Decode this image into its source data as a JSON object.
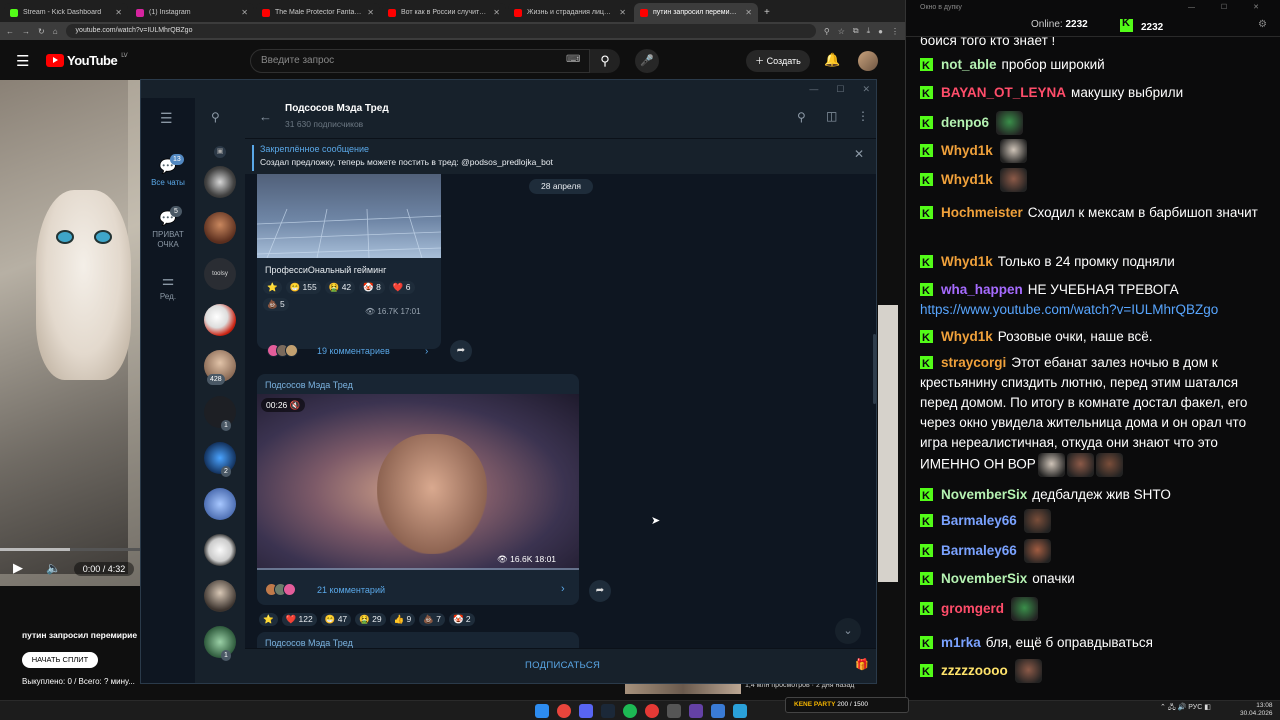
{
  "browser": {
    "tabs": [
      {
        "title": "Stream - Kick Dashboard",
        "color": "#53fc18"
      },
      {
        "title": "(1) Instagram",
        "color": "#d6249f"
      },
      {
        "title": "The Male Protector Fantasy | ",
        "color": "#ff0000"
      },
      {
        "title": "Вот как в России случится де",
        "color": "#ff0000"
      },
      {
        "title": "Жизнь и страдания лицемер",
        "color": "#ff0000"
      },
      {
        "title": "путин запросил перемирие",
        "color": "#ff0000"
      }
    ],
    "new_tab": "+",
    "url": "youtube.com/watch?v=IULMhrQBZgo"
  },
  "youtube": {
    "logo_text": "YouTube",
    "region": "LV",
    "search_placeholder": "Введите запрос",
    "create_label": "Создать",
    "timecode": "0:00 / 4:32",
    "progress": 0.0,
    "video_title": "путин запросил перемирие",
    "split_label": "НАЧАТЬ СПЛИТ",
    "bought": "Выкуплено: 0 / Всего: ? мину...",
    "views_strip": "1,4 млн просмотров · 2 дня назад"
  },
  "telegram": {
    "rail": {
      "all_chats": "Все чаты",
      "all_badge": "13",
      "private_label": "ПРИВАТ ОЧКА",
      "private_badge": "5",
      "edit_label": "Ред."
    },
    "chat_list_badges": [
      "428",
      "1",
      "2",
      "1"
    ],
    "list_label_toolsy": "toolsy",
    "channel_name": "Подсосов Мэда Тред",
    "subscribers": "31 630 подписчиков",
    "pinned_title": "Закреплённое сообщение",
    "pinned_text": "Создал предложку, теперь можете  постить в тред: @podsos_predlojka_bot",
    "date": "28 апреля",
    "post1": {
      "caption": "ПрофессиОнальный гейминг",
      "reactions": [
        {
          "emoji": "⭐",
          "count": ""
        },
        {
          "emoji": "😁",
          "count": "155"
        },
        {
          "emoji": "🤮",
          "count": "42"
        },
        {
          "emoji": "🤡",
          "count": "8"
        },
        {
          "emoji": "❤️",
          "count": "6"
        },
        {
          "emoji": "💩",
          "count": "5"
        }
      ],
      "views": "16.7K",
      "time": "17:01",
      "comments": "19 комментариев"
    },
    "post2": {
      "sender": "Подсосов Мэда Тред",
      "duration": "00:26",
      "views": "16.6K",
      "time": "18:01",
      "comments": "21 комментарий",
      "reactions": [
        {
          "emoji": "⭐",
          "count": ""
        },
        {
          "emoji": "❤️",
          "count": "122"
        },
        {
          "emoji": "😁",
          "count": "47"
        },
        {
          "emoji": "🤮",
          "count": "29"
        },
        {
          "emoji": "👍",
          "count": "9"
        },
        {
          "emoji": "💩",
          "count": "7"
        },
        {
          "emoji": "🤡",
          "count": "2"
        }
      ]
    },
    "post3_sender": "Подсосов Мэда Тред",
    "subscribe_label": "ПОДПИСАТЬСЯ"
  },
  "chat": {
    "window_title": "Окно в дупку",
    "online_label": "Online:",
    "online_count": "2232",
    "kick_count": "2232",
    "accent": "#53fc18",
    "messages": [
      {
        "user": "",
        "color": "#ffffff",
        "text": "боися того кто знает !",
        "emotes": 0
      },
      {
        "user": "not_able",
        "color": "#b5f2b2",
        "text": "пробор широкий",
        "emotes": 0
      },
      {
        "user": "BAYAN_OT_LEYNA",
        "color": "#ff4d6a",
        "text": "макушку выбрили",
        "emotes": 0
      },
      {
        "user": "denpo6",
        "color": "#b5f2b2",
        "text": "",
        "emotes": 1
      },
      {
        "user": "Whyd1k",
        "color": "#f0a13b",
        "text": "",
        "emotes": 1
      },
      {
        "user": "Whyd1k",
        "color": "#f0a13b",
        "text": "",
        "emotes": 1
      },
      {
        "user": "Hochmeister",
        "color": "#f0a13b",
        "text": "Сходил к мексам в барбишоп значит",
        "emotes": 0
      },
      {
        "user": "Whyd1k",
        "color": "#f0a13b",
        "text": "Только в 24 промку подняли",
        "emotes": 0
      },
      {
        "user": "wha_happen",
        "color": "#a66bff",
        "text": "НЕ УЧЕБНАЯ ТРЕВОГА",
        "emotes": 0,
        "link": "https://www.youtube.com/watch?v=IULMhrQBZgo"
      },
      {
        "user": "Whyd1k",
        "color": "#f0a13b",
        "text": "Розовые очки, наше всё.",
        "emotes": 0
      },
      {
        "user": "straycorgi",
        "color": "#f0a13b",
        "text": "Этот ебанат залез ночью в дом к крестьянину спиздить лютню, перед этим шатался перед домом. По итогу в комнате достал факел, его через окно увидела жительница дома и он орал что игра нереалистичная, откуда они знают что это ИМЕННО ОН ВОР",
        "emotes": 3
      },
      {
        "user": "NovemberSix",
        "color": "#b5f2b2",
        "text": "дедбалдеж жив SHTO",
        "emotes": 0
      },
      {
        "user": "Barmaley66",
        "color": "#7aa2ff",
        "text": "",
        "emotes": 1
      },
      {
        "user": "Barmaley66",
        "color": "#7aa2ff",
        "text": "",
        "emotes": 1
      },
      {
        "user": "NovemberSix",
        "color": "#b5f2b2",
        "text": "опачки",
        "emotes": 0
      },
      {
        "user": "gromgerd",
        "color": "#ff4d6a",
        "text": "",
        "emotes": 1
      },
      {
        "user": "m1rka",
        "color": "#7aa2ff",
        "text": "бля, ещё б оправдываться",
        "emotes": 0
      },
      {
        "user": "zzzzzoooo",
        "color": "#ffe36b",
        "text": "",
        "emotes": 1
      }
    ]
  },
  "taskbar": {
    "kick_overlay_name": "KENE PARTY",
    "kick_overlay_count": "200 / 1500",
    "lang": "РУС",
    "time": "13:08",
    "date": "30.04.2026"
  }
}
